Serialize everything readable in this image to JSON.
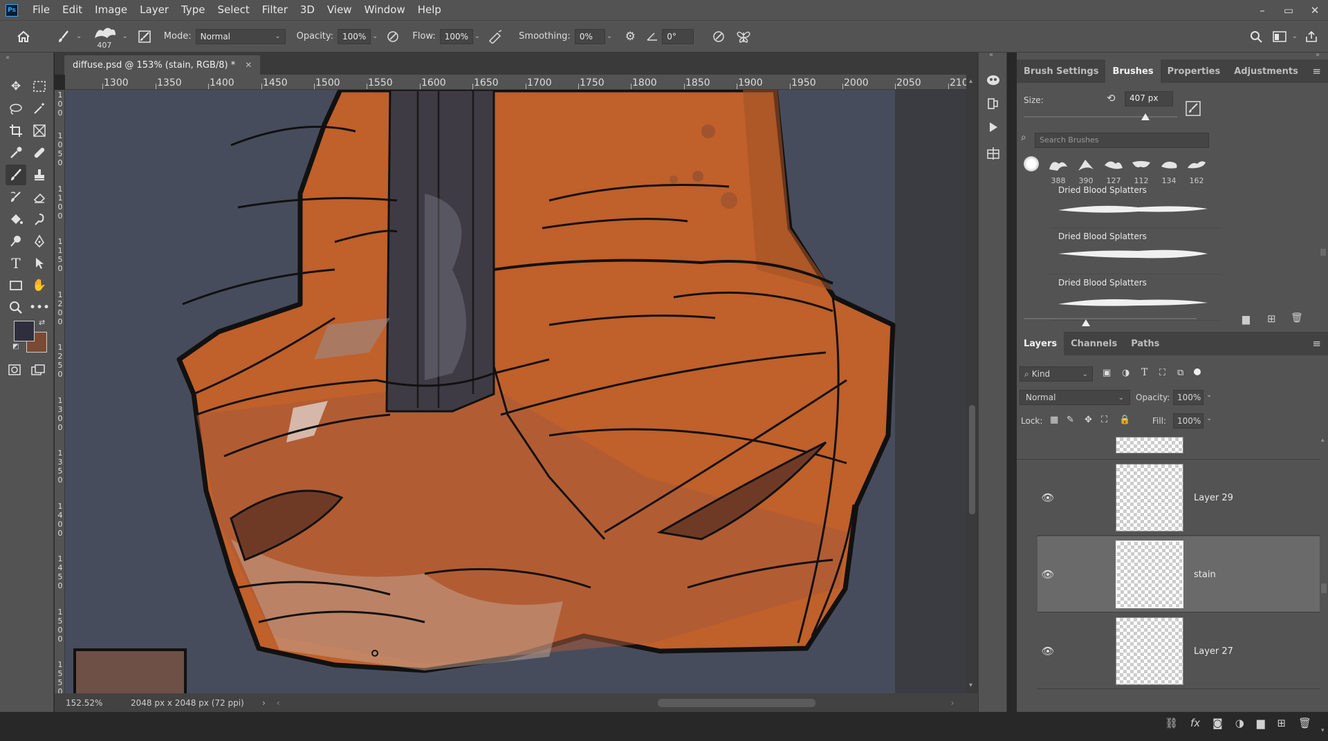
{
  "menu": {
    "items": [
      "File",
      "Edit",
      "Image",
      "Layer",
      "Type",
      "Select",
      "Filter",
      "3D",
      "View",
      "Window",
      "Help"
    ],
    "logo": "Ps",
    "minimize": "–",
    "restore": "▭",
    "close": "✕"
  },
  "options_bar": {
    "brush_size": "407",
    "mode_label": "Mode:",
    "mode_value": "Normal",
    "opacity_label": "Opacity:",
    "opacity_value": "100%",
    "flow_label": "Flow:",
    "flow_value": "100%",
    "smoothing_label": "Smoothing:",
    "smoothing_value": "0%",
    "angle_value": "0°"
  },
  "document": {
    "tab_title": "diffuse.psd @ 153% (stain, RGB/8) *",
    "close": "✕",
    "zoom": "152.52%",
    "info": "2048 px x 2048 px (72 ppi)"
  },
  "rulers": {
    "horizontal": [
      "1300",
      "1350",
      "1400",
      "1450",
      "1500",
      "1550",
      "1600",
      "1650",
      "1700",
      "1750",
      "1800",
      "1850",
      "1900",
      "1950",
      "2000",
      "2050",
      "210"
    ],
    "vertical": [
      "1\n0\n0",
      "1\n0\n5\n0",
      "1\n1\n0\n0",
      "1\n1\n5\n0",
      "1\n2\n0\n0",
      "1\n2\n5\n0",
      "1\n3\n0\n0",
      "1\n3\n5\n0",
      "1\n4\n0\n0",
      "1\n4\n5\n0",
      "1\n5\n0\n0",
      "1\n5\n5\n0",
      "1\n6\n0\n0",
      "1\n6\n5\n0"
    ]
  },
  "brushes_panel": {
    "tabs": [
      "Brush Settings",
      "Brushes",
      "Properties",
      "Adjustments"
    ],
    "active_tab": "Brushes",
    "size_label": "Size:",
    "size_value": "407 px",
    "search_placeholder": "Search Brushes",
    "presets": [
      "388",
      "390",
      "127",
      "112",
      "134",
      "162"
    ],
    "list": [
      "Dried Blood Splatters",
      "Dried Blood Splatters",
      "Dried Blood Splatters"
    ]
  },
  "layers_panel": {
    "tabs": [
      "Layers",
      "Channels",
      "Paths"
    ],
    "active_tab": "Layers",
    "kind_label": "Kind",
    "blend_mode": "Normal",
    "opacity_label": "Opacity:",
    "opacity_value": "100%",
    "lock_label": "Lock:",
    "fill_label": "Fill:",
    "fill_value": "100%",
    "layers": [
      {
        "name": "Layer 29",
        "visible": true,
        "selected": false
      },
      {
        "name": "stain",
        "visible": true,
        "selected": true
      },
      {
        "name": "Layer 27",
        "visible": true,
        "selected": false
      }
    ]
  },
  "colors": {
    "foreground": "#2e2e3e",
    "background": "#7a4a32",
    "canvas_bg": "#474c5c",
    "cloth": "#c0602a"
  }
}
